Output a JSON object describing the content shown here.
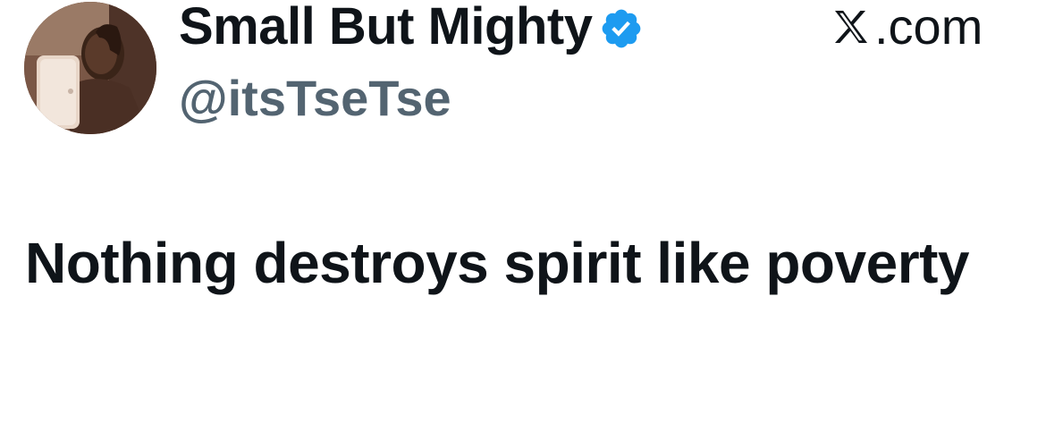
{
  "author": {
    "display_name": "Small But Mighty",
    "handle": "@itsTseTse",
    "verified": true,
    "avatar_icon": "profile-photo"
  },
  "source": {
    "logo_icon": "x-logo-icon",
    "label": ".com"
  },
  "tweet": {
    "text": "Nothing destroys spirit like poverty"
  },
  "colors": {
    "text_primary": "#0f1419",
    "text_secondary": "#536471",
    "verified_blue": "#1d9bf0",
    "background": "#ffffff"
  }
}
